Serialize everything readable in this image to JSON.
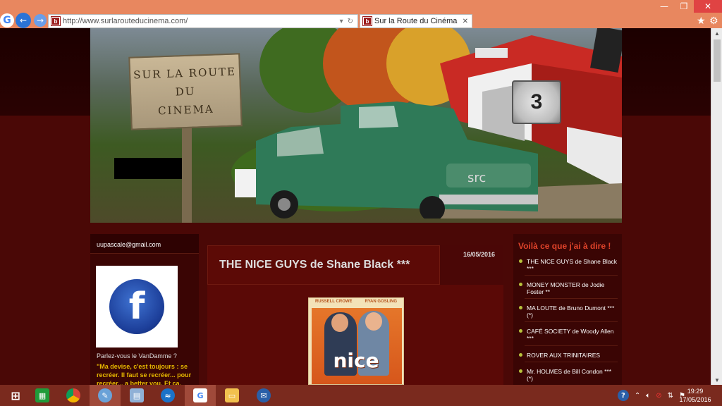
{
  "browser": {
    "url": "http://www.surlarouteducinema.com/",
    "tab_title": "Sur la Route du Cinéma",
    "favicon_letter": "b",
    "icons": [
      "google-icon",
      "back-icon",
      "forward-icon",
      "search-dropdown-icon",
      "refresh-icon",
      "tab-close-icon",
      "star-icon",
      "gear-icon",
      "minimize-icon",
      "restore-icon",
      "close-icon"
    ]
  },
  "banner": {
    "sign_text": "SUR LA ROUTE\nDU\nCINEMA",
    "clapper_number": "3"
  },
  "left_sidebar": {
    "email": "uupascale@gmail.com",
    "facebook_letter": "f",
    "question": "Parlez-vous le VanDamme ?",
    "quote": "\"Ma devise, c'est toujours : se recréer. Il faut se recréer... pour recréer... a better you. Et ça, c'est"
  },
  "post": {
    "title": "THE NICE GUYS de Shane Black ***",
    "date": "16/05/2016",
    "poster": {
      "actor_left": "RUSSELL CROWE",
      "actor_right": "RYAN GOSLING",
      "logo": "nice"
    }
  },
  "right_sidebar": {
    "title": "Voilà ce que j'ai à dire !",
    "items": [
      "THE NICE GUYS de Shane Black ***",
      "MONEY MONSTER de Jodie Foster **",
      "MA LOUTE de Bruno Dumont *** (*)",
      "CAFÉ SOCIETY de Woody Allen ***",
      "ROVER AUX TRINITAIRES",
      "Mr. HOLMES de Bill Condon *** (*)"
    ]
  },
  "taskbar": {
    "apps": [
      "windows-start-icon",
      "store-icon",
      "chrome-icon",
      "paint-icon",
      "calculator-icon",
      "app-wing-icon",
      "google-icon",
      "file-explorer-icon",
      "thunderbird-icon"
    ],
    "tray_icons": [
      "help-icon",
      "show-hidden-icon",
      "volume-icon",
      "antivirus-icon",
      "network-icon",
      "flag-icon"
    ],
    "time": "19:29",
    "date": "17/05/2016"
  }
}
